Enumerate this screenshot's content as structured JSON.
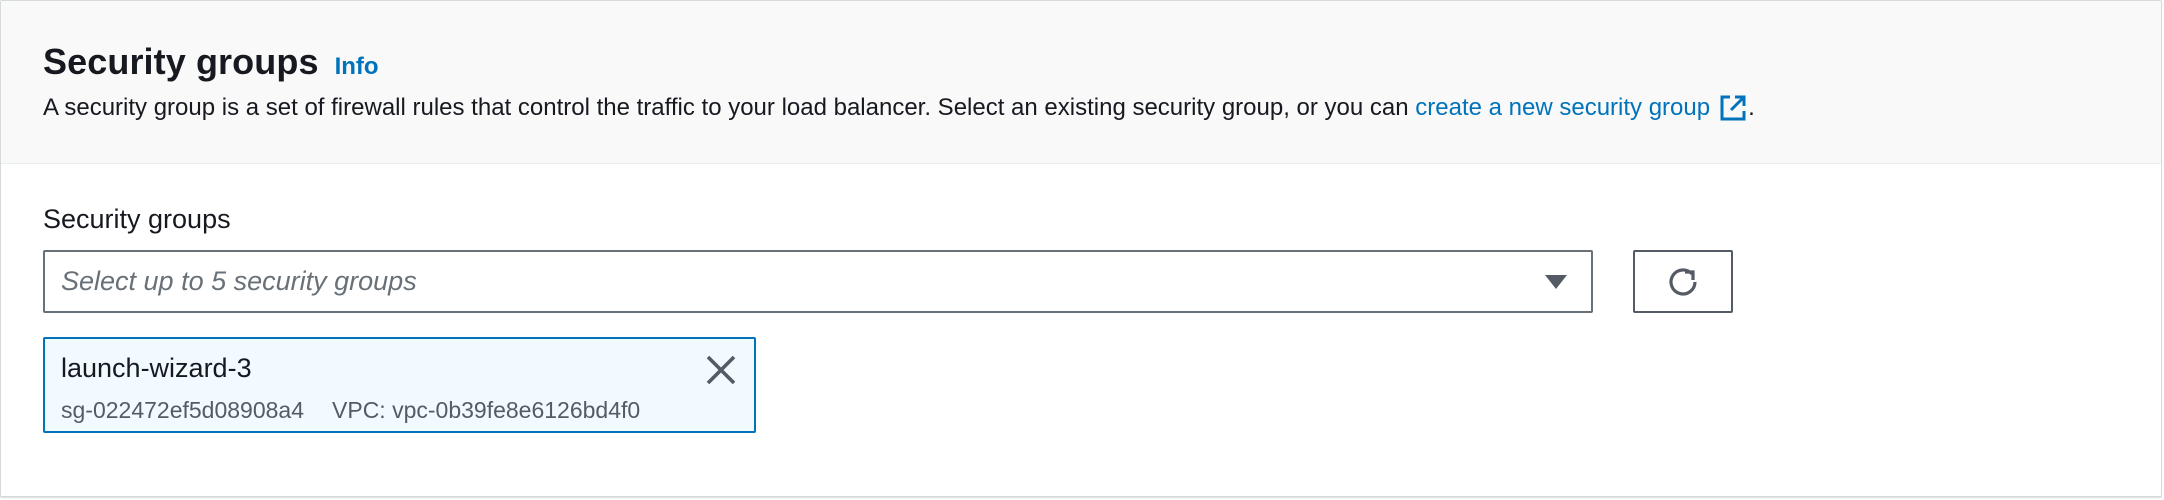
{
  "header": {
    "title": "Security groups",
    "info_label": "Info",
    "description_prefix": "A security group is a set of firewall rules that control the traffic to your load balancer. Select an existing security group, or you can ",
    "create_link_label": "create a new security group",
    "description_suffix": "."
  },
  "field": {
    "label": "Security groups",
    "placeholder": "Select up to 5 security groups"
  },
  "selected_groups": [
    {
      "name": "launch-wizard-3",
      "id": "sg-022472ef5d08908a4",
      "vpc": "VPC: vpc-0b39fe8e6126bd4f0"
    }
  ],
  "icons": {
    "external": "external-link-icon",
    "caret": "caret-down-icon",
    "refresh": "refresh-icon",
    "dismiss": "close-icon"
  },
  "colors": {
    "link": "#0073bb",
    "token_background": "#f1faff",
    "token_border": "#0073bb",
    "header_background": "#f9f9f9"
  }
}
